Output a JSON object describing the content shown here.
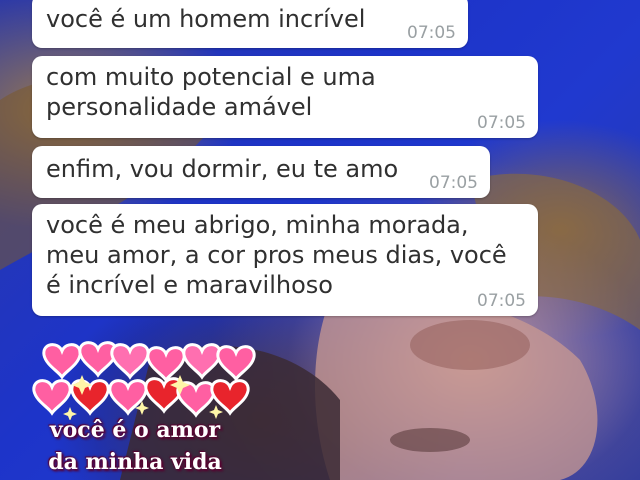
{
  "messages": [
    {
      "text": "você é um homem incrível",
      "time": "07:05"
    },
    {
      "text": "com muito potencial e uma\npersonalidade amável",
      "time": "07:05"
    },
    {
      "text": "enfim, vou dormir, eu te amo",
      "time": "07:05"
    },
    {
      "text": "você é meu abrigo, minha morada,\nmeu amor, a cor pros meus dias, você\né incrível e maravilhoso",
      "time": "07:05"
    }
  ],
  "sticker": {
    "line1": "você é o amor",
    "line2": "da minha vida"
  },
  "colors": {
    "bubble": "#ffffff",
    "timestamp": "#9aa0a3",
    "heart_red": "#e8242c",
    "heart_pink": "#ff5fa2"
  }
}
